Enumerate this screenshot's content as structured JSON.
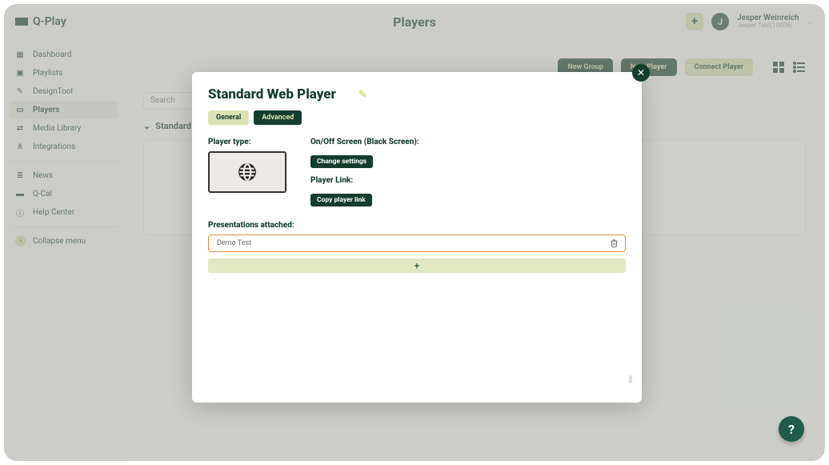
{
  "brand": {
    "name": "Q-Play"
  },
  "header": {
    "title": "Players",
    "add_label": "+",
    "user": {
      "initial": "J",
      "name": "Jesper Weinreich",
      "tenant": "Jesper Test(10006)"
    }
  },
  "sidebar": {
    "items": [
      {
        "icon": "dashboard-icon",
        "label": "Dashboard"
      },
      {
        "icon": "playlists-icon",
        "label": "Playlists"
      },
      {
        "icon": "designtool-icon",
        "label": "DesignTool"
      },
      {
        "icon": "players-icon",
        "label": "Players",
        "active": true
      },
      {
        "icon": "media-icon",
        "label": "Media Library"
      },
      {
        "icon": "integrations-icon",
        "label": "Integrations"
      }
    ],
    "secondary": [
      {
        "icon": "news-icon",
        "label": "News"
      },
      {
        "icon": "qcal-icon",
        "label": "Q-Cal"
      },
      {
        "icon": "help-icon",
        "label": "Help Center"
      }
    ],
    "collapse_label": "Collapse menu"
  },
  "toolbar": {
    "new_group": "New Group",
    "new_player": "New Player",
    "connect_player": "Connect Player"
  },
  "search": {
    "placeholder": "Search"
  },
  "group": {
    "name": "Standard"
  },
  "modal": {
    "title": "Standard Web Player",
    "tabs": {
      "general": "General",
      "advanced": "Advanced"
    },
    "player_type_label": "Player type:",
    "left": {
      "presentations_label": "Presentations attached:"
    },
    "right": {
      "onoff_label": "On/Off Screen (Black Screen):",
      "change_settings": "Change settings",
      "link_label": "Player Link:",
      "copy_link": "Copy player link"
    },
    "presentation_rows": [
      {
        "name": "Demo Test"
      }
    ],
    "add_row": "+"
  },
  "fab": {
    "label": "?"
  }
}
